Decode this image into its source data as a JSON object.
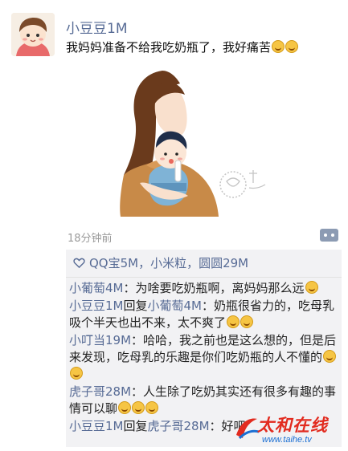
{
  "post": {
    "author": "小豆豆1M",
    "text": "我妈妈准备不给我吃奶瓶了，我好痛苦",
    "time": "18分钟前",
    "emoji": "grin-emoji"
  },
  "likes": {
    "names": "QQ宝5M，小米粒，圆圆29M"
  },
  "comments": [
    {
      "name": "小葡萄4M",
      "reply_to": "",
      "text": "：为啥要吃奶瓶啊，离妈妈那么远"
    },
    {
      "name": "小豆豆1M",
      "reply_label": "回复",
      "reply_to": "小葡萄4M",
      "text": "：奶瓶很省力的，吃母乳吸个半天也出不来，太不爽了"
    },
    {
      "name": "小叮当19M",
      "reply_to": "",
      "text": "：哈哈，我之前也是这么想的，但是后来发现，吃母乳的乐趣是你们吃奶瓶的人不懂的"
    },
    {
      "name": "虎子哥28M",
      "reply_to": "",
      "text": "：人生除了吃奶其实还有很多有趣的事情可以聊"
    },
    {
      "name": "小豆豆1M",
      "reply_label": "回复",
      "reply_to": "虎子哥28M",
      "text": "：好吧"
    }
  ],
  "watermark": {
    "title": "太和在线",
    "url": "www.taihe.tv"
  },
  "colors": {
    "link": "#576b95",
    "comment_bg": "#f2f2f4"
  }
}
